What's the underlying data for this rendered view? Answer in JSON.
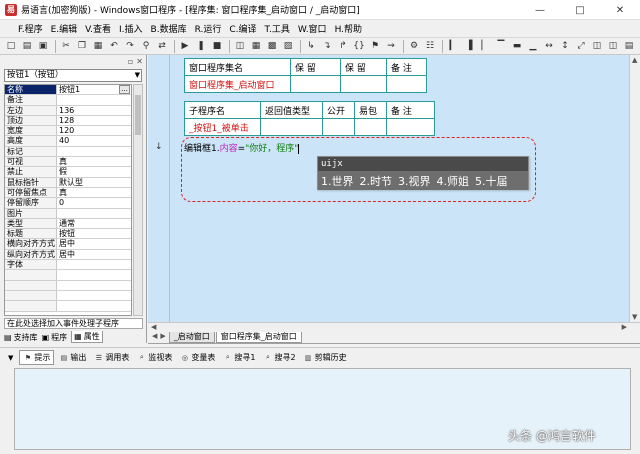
{
  "window": {
    "title": "易语言(加密狗版) - Windows窗口程序 - [程序集: 窗口程序集_启动窗口 / _启动窗口]",
    "app_icon_text": "易"
  },
  "menu": [
    "F.程序",
    "E.编辑",
    "V.查看",
    "I.插入",
    "B.数据库",
    "R.运行",
    "C.编译",
    "T.工具",
    "W.窗口",
    "H.帮助"
  ],
  "left_panel": {
    "object_selector": "按钮1（按钮）",
    "properties": [
      {
        "name": "名称",
        "value": "按钮1",
        "selected": true
      },
      {
        "name": "备注",
        "value": ""
      },
      {
        "name": "左边",
        "value": "136"
      },
      {
        "name": "顶边",
        "value": "128"
      },
      {
        "name": "宽度",
        "value": "120"
      },
      {
        "name": "高度",
        "value": "40"
      },
      {
        "name": "标记",
        "value": ""
      },
      {
        "name": "可视",
        "value": "真"
      },
      {
        "name": "禁止",
        "value": "假"
      },
      {
        "name": "鼠标指针",
        "value": "默认型"
      },
      {
        "name": "可停留焦点",
        "value": "真"
      },
      {
        "name": "停留顺序",
        "value": "0"
      },
      {
        "name": "图片",
        "value": ""
      },
      {
        "name": "类型",
        "value": "通常"
      },
      {
        "name": "标题",
        "value": "按钮"
      },
      {
        "name": "横向对齐方式",
        "value": "居中"
      },
      {
        "name": "纵向对齐方式",
        "value": "居中"
      },
      {
        "name": "字体",
        "value": ""
      },
      {
        "name": "",
        "value": ""
      },
      {
        "name": "",
        "value": ""
      },
      {
        "name": "",
        "value": ""
      },
      {
        "name": "",
        "value": ""
      }
    ],
    "hint": "在此处选择加入事件处理子程序",
    "tabs": [
      {
        "label": "支持库",
        "icon": "book-icon",
        "active": false
      },
      {
        "label": "程序",
        "icon": "program-icon",
        "active": false
      },
      {
        "label": "属性",
        "icon": "properties-icon",
        "active": true
      }
    ]
  },
  "editor": {
    "assembly_table": {
      "headers": [
        "窗口程序集名",
        "保 留",
        "保 留",
        "备 注"
      ],
      "row": [
        "窗口程序集_启动窗口",
        "",
        "",
        ""
      ]
    },
    "sub_table": {
      "headers": [
        "子程序名",
        "返回值类型",
        "公开",
        "易包",
        "备 注"
      ],
      "row": [
        "_按钮1_被单击",
        "",
        "",
        "",
        ""
      ]
    },
    "code": {
      "object": "编辑框1.",
      "property": "内容",
      "operator": "=",
      "string": "\"你好，程序\""
    },
    "ime": {
      "composition": "uijx",
      "candidates": [
        "1.世界",
        "2.时节",
        "3.视界",
        "4.师姐",
        "5.十届"
      ]
    },
    "tabs": [
      {
        "label": "_启动窗口",
        "active": false
      },
      {
        "label": "窗口程序集_启动窗口",
        "active": true
      }
    ]
  },
  "output_bar": {
    "items": [
      {
        "label": "提示",
        "icon": "tip-icon",
        "active": true
      },
      {
        "label": "输出",
        "icon": "output-icon",
        "active": false
      },
      {
        "label": "调用表",
        "icon": "callstack-icon",
        "active": false
      },
      {
        "label": "监视表",
        "icon": "watch-icon",
        "active": false
      },
      {
        "label": "变量表",
        "icon": "variables-icon",
        "active": false
      },
      {
        "label": "搜寻1",
        "icon": "search-icon",
        "active": false
      },
      {
        "label": "搜寻2",
        "icon": "search-icon",
        "active": false
      },
      {
        "label": "剪辑历史",
        "icon": "clipboard-icon",
        "active": false
      }
    ]
  },
  "watermark": "头条 @鸿言软件"
}
